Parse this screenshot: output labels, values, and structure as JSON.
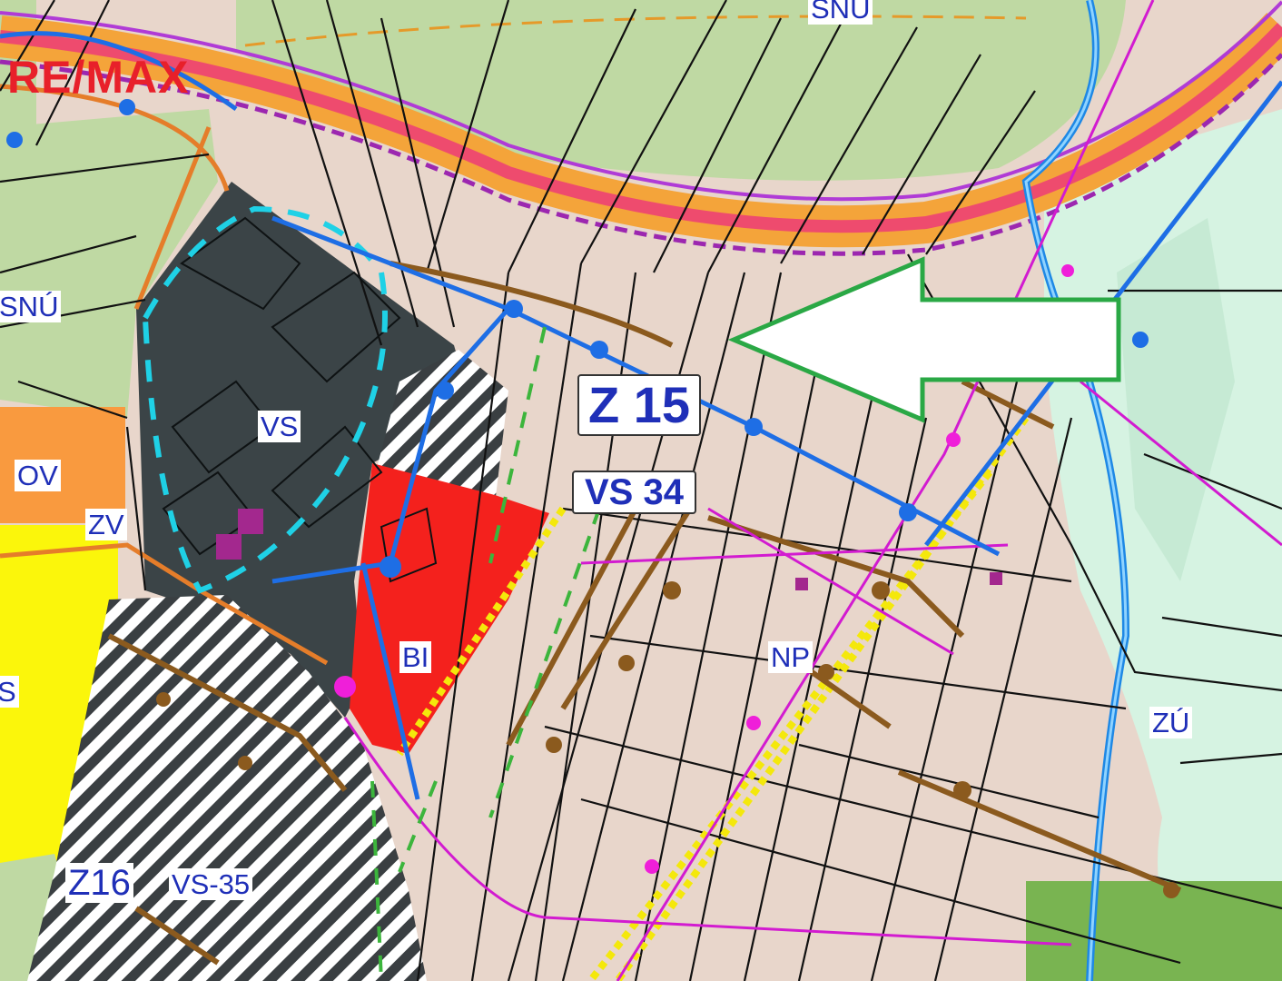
{
  "map": {
    "watermark": "RE/MAX",
    "labels": {
      "snu_top": "SNÚ",
      "snu_left": "SNÚ",
      "vs": "VS",
      "ov": "OV",
      "zv": "ZV",
      "s": "S",
      "bi": "BI",
      "z15": "Z 15",
      "vs34": "VS 34",
      "np": "NP",
      "zu": "ZÚ",
      "z16": "Z16",
      "vs35": "VS-35"
    },
    "icons": {
      "arrow": "highlight-arrow-left",
      "watermark": "remax-logo"
    },
    "colors": {
      "meadow": "#bfd9a3",
      "arable": "#e8d6cb",
      "building_block": "#3b4447",
      "housing_bi": "#f4211d",
      "civic_ov": "#f99a3f",
      "residential_s": "#fbf60b",
      "park_zu": "#d6f3e2",
      "road": "#f4a43a",
      "railway_stripe": "#ee4b6e",
      "water": "#1e88e5",
      "boundary": "#e57d2a",
      "arrow_outline": "#2aa845",
      "label_text": "#1f2fb8"
    }
  }
}
